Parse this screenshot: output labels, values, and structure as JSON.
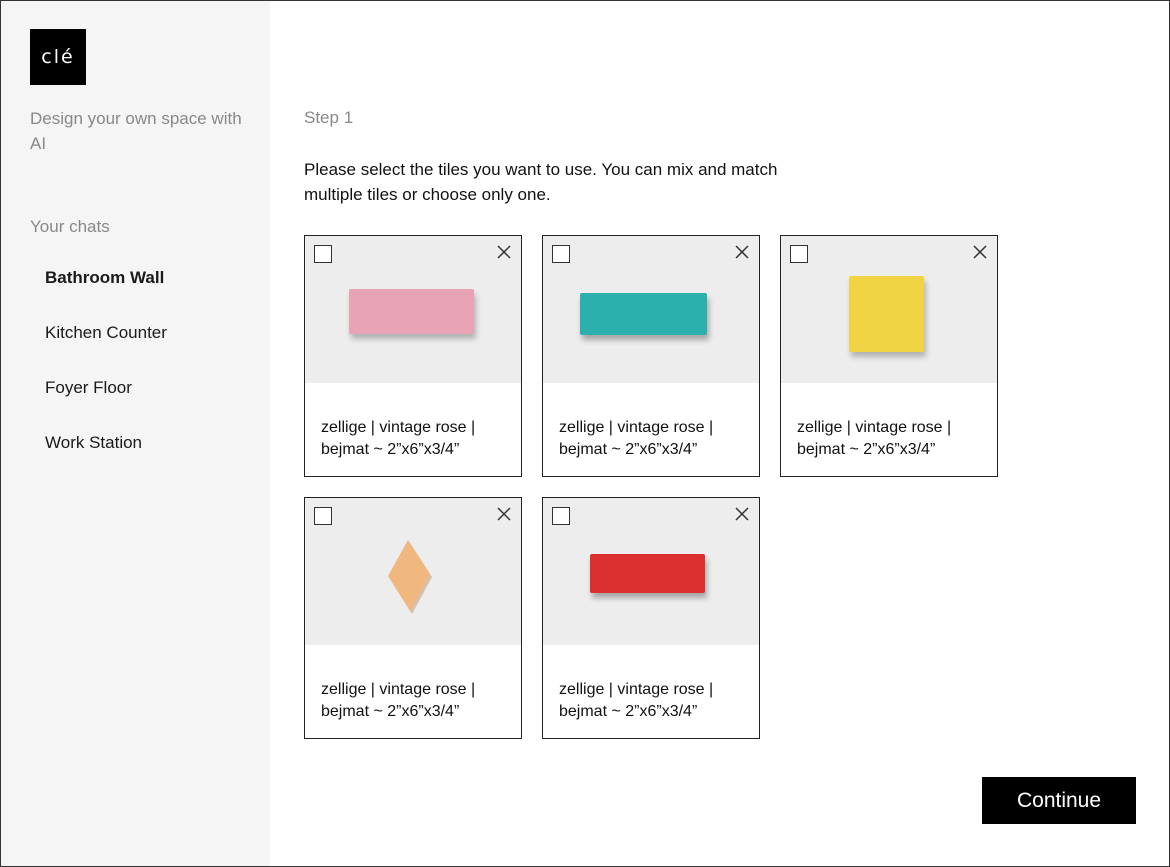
{
  "sidebar": {
    "logo_text": "clé",
    "tagline": "Design your own space with AI",
    "chats_heading": "Your chats",
    "chats": [
      {
        "label": "Bathroom Wall",
        "active": true
      },
      {
        "label": "Kitchen Counter",
        "active": false
      },
      {
        "label": "Foyer Floor",
        "active": false
      },
      {
        "label": "Work Station",
        "active": false
      }
    ]
  },
  "main": {
    "step_label": "Step 1",
    "instructions": "Please select the tiles you want to use. You can mix and match multiple tiles or choose only one.",
    "tiles": [
      {
        "caption_line1": "zellige | vintage rose |",
        "caption_line2": "bejmat ~ 2”x6”x3/4”",
        "color": "#e8a3b4",
        "shape": "rectangle",
        "checked": false
      },
      {
        "caption_line1": "zellige | vintage rose |",
        "caption_line2": "bejmat ~ 2”x6”x3/4”",
        "color": "#2bb0ad",
        "shape": "rectangle",
        "checked": false
      },
      {
        "caption_line1": "zellige | vintage rose |",
        "caption_line2": "bejmat ~ 2”x6”x3/4”",
        "color": "#f0d444",
        "shape": "square",
        "checked": false
      },
      {
        "caption_line1": "zellige | vintage rose |",
        "caption_line2": "bejmat ~ 2”x6”x3/4”",
        "color": "#f0b87e",
        "shape": "diamond",
        "checked": false
      },
      {
        "caption_line1": "zellige | vintage rose |",
        "caption_line2": "bejmat ~ 2”x6”x3/4”",
        "color": "#dc2f30",
        "shape": "rectangle",
        "checked": false
      }
    ],
    "continue_label": "Continue"
  },
  "icons": {
    "checkbox": "checkbox-icon",
    "close": "close-icon"
  }
}
